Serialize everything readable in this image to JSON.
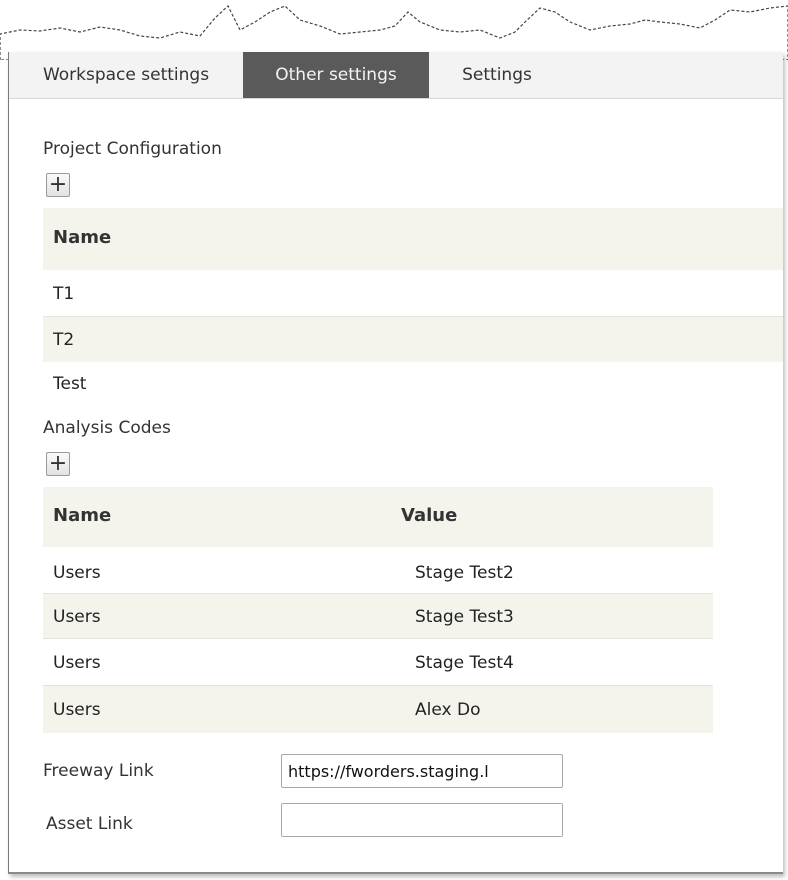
{
  "tabs": [
    {
      "label": "Workspace settings",
      "active": false
    },
    {
      "label": "Other settings",
      "active": true
    },
    {
      "label": "Settings",
      "active": false
    }
  ],
  "project_configuration": {
    "title": "Project Configuration",
    "add_label": "+",
    "columns": [
      "Name"
    ],
    "rows": [
      "T1",
      "T2",
      "Test"
    ]
  },
  "analysis_codes": {
    "title": "Analysis Codes",
    "add_label": "+",
    "columns": [
      "Name",
      "Value"
    ],
    "rows": [
      {
        "name": "Users",
        "value": "Stage Test2"
      },
      {
        "name": "Users",
        "value": "Stage Test3"
      },
      {
        "name": "Users",
        "value": "Stage Test4"
      },
      {
        "name": "Users",
        "value": "Alex Do"
      }
    ]
  },
  "links": {
    "freeway_label": "Freeway Link",
    "freeway_value": "https://fworders.staging.l",
    "asset_label": "Asset Link",
    "asset_value": ""
  },
  "colors": {
    "active_tab": "#5a5a5a",
    "row_alt": "#f4f4ec",
    "tabbar": "#f3f3f3"
  }
}
